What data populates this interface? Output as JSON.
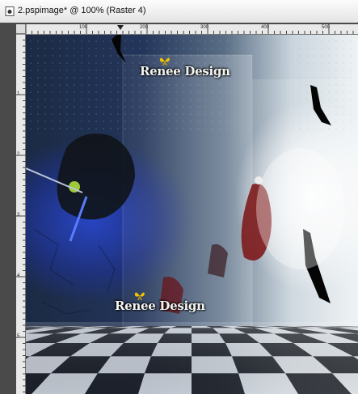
{
  "window": {
    "title": "2.pspimage* @ 100% (Raster 4)",
    "icon": "document-icon"
  },
  "ruler": {
    "top_labels": [
      "100",
      "200",
      "300",
      "400",
      "500"
    ],
    "left_labels": [
      "1",
      "2",
      "3",
      "4",
      "5"
    ]
  },
  "canvas": {
    "watermark_top": "Renee Design",
    "watermark_bottom": "Renee Design",
    "colors": {
      "blue": "#2a46c8",
      "dark": "#1b2a44",
      "light": "#eef2f4",
      "butterfly": "#f2c500"
    }
  }
}
